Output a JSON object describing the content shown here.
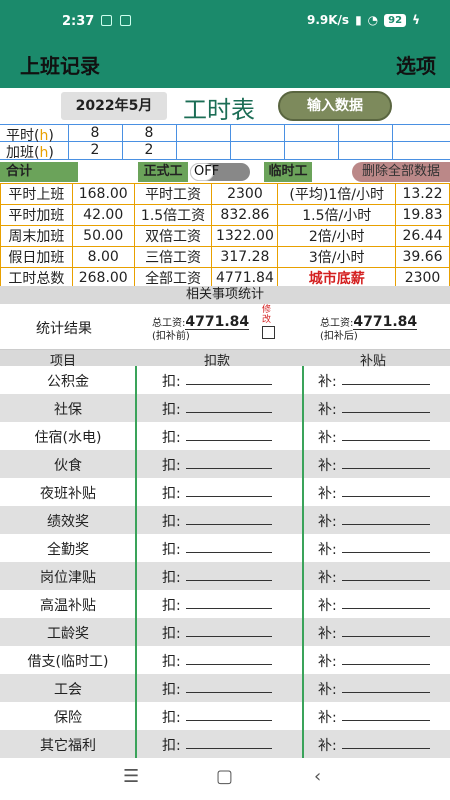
{
  "status": {
    "time": "2:37",
    "speed": "9.9K/s",
    "battery": "92"
  },
  "appbar": {
    "title": "上班记录",
    "options": "选项"
  },
  "toolbar": {
    "date": "2022年5月",
    "title": "工时表",
    "input": "输入数据"
  },
  "hours": {
    "row1": {
      "label": "平时",
      "unit": "h",
      "values": [
        "8",
        "8"
      ]
    },
    "row2": {
      "label": "加班",
      "unit": "h",
      "values": [
        "2",
        "2"
      ]
    }
  },
  "sumbar": {
    "total": "合计",
    "regular": "正式工",
    "toggle": "OFF",
    "temp": "临时工",
    "delete": "删除全部数据"
  },
  "stats": [
    [
      "平时上班",
      "168.00",
      "平时工资",
      "2300",
      "(平均)1倍/小时",
      "13.22"
    ],
    [
      "平时加班",
      "42.00",
      "1.5倍工资",
      "832.86",
      "1.5倍/小时",
      "19.83"
    ],
    [
      "周末加班",
      "50.00",
      "双倍工资",
      "1322.00",
      "2倍/小时",
      "26.44"
    ],
    [
      "假日加班",
      "8.00",
      "三倍工资",
      "317.28",
      "3倍/小时",
      "39.66"
    ],
    [
      "工时总数",
      "268.00",
      "全部工资",
      "4771.84",
      "城市底薪",
      "2300"
    ]
  ],
  "summary": {
    "section": "相关事项统计",
    "result_label": "统计结果",
    "total_label": "总工资:",
    "before": "(扣补前)",
    "after": "(扣补后)",
    "value_before": "4771.84",
    "value_after": "4771.84",
    "modify": "修改"
  },
  "columns": {
    "item": "项目",
    "deduct": "扣款",
    "subsidy": "补贴"
  },
  "prefix": {
    "deduct": "扣:",
    "subsidy": "补:"
  },
  "items": [
    "公积金",
    "社保",
    "住宿(水电)",
    "伙食",
    "夜班补贴",
    "绩效奖",
    "全勤奖",
    "岗位津贴",
    "高温补贴",
    "工龄奖",
    "借支(临时工)",
    "工会",
    "保险",
    "其它福利"
  ],
  "nav": {
    "menu": "☰",
    "home": "▢",
    "back": "‹"
  }
}
